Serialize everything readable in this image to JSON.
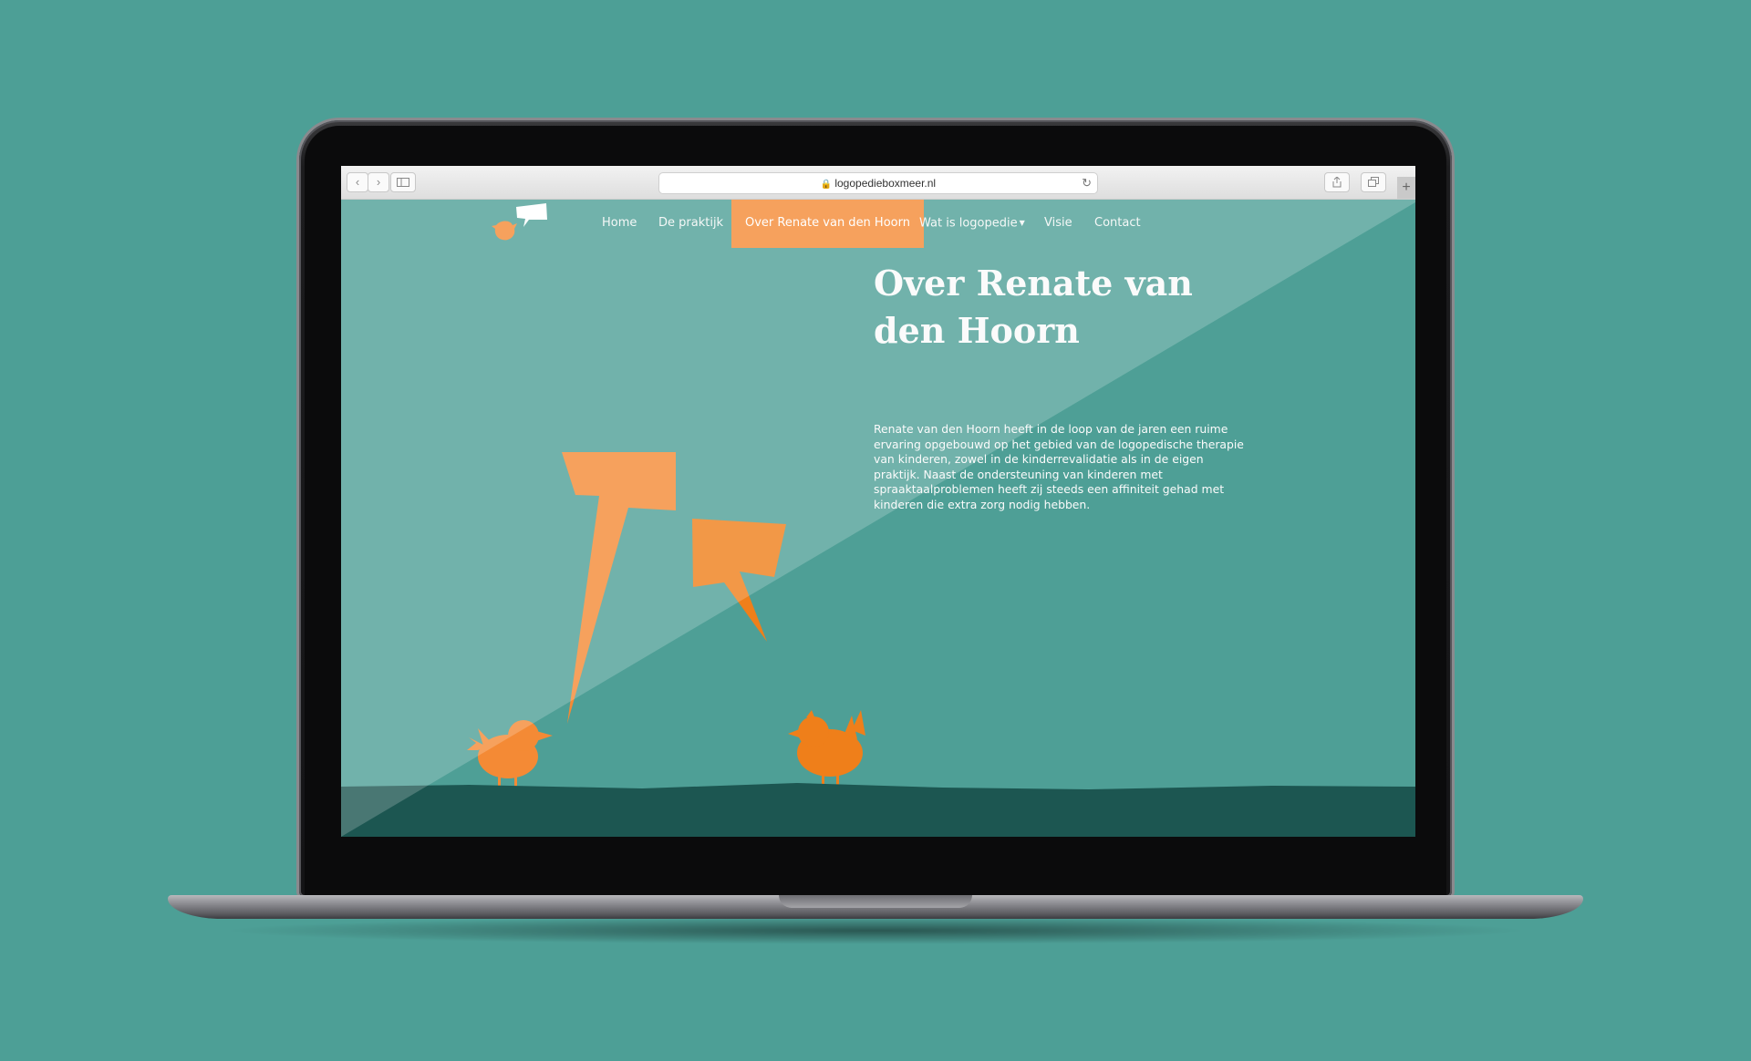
{
  "browser": {
    "url": "logopedieboxmeer.nl",
    "back_icon": "chevron-left-icon",
    "forward_icon": "chevron-right-icon",
    "sidebar_icon": "sidebar-icon",
    "reload_icon": "reload-icon",
    "share_icon": "share-icon",
    "tabs_icon": "tabs-icon",
    "new_tab_label": "+"
  },
  "site": {
    "nav": [
      {
        "label": "Home",
        "active": false
      },
      {
        "label": "De praktijk",
        "active": false
      },
      {
        "label": "Over Renate van den Hoorn",
        "active": true
      },
      {
        "label": "Wat is logopedie",
        "active": false,
        "has_dropdown": true
      },
      {
        "label": "Visie",
        "active": false
      },
      {
        "label": "Contact",
        "active": false
      }
    ],
    "title": "Over Renate van den Hoorn",
    "intro": "Renate van den Hoorn heeft in de loop van de jaren een ruime ervaring opgebouwd op het gebied van de logopedische therapie van kinderen, zowel in de kinderrevalidatie als in de eigen praktijk. Naast de ondersteuning van kinderen met spraaktaalproblemen heeft zij steeds een affiniteit gehad met kinderen die extra zorg nodig hebben."
  },
  "colors": {
    "background": "#4d9f96",
    "accent_orange": "#f48a35",
    "dark_orange": "#ef7f1a",
    "ground": "#1c5651"
  }
}
